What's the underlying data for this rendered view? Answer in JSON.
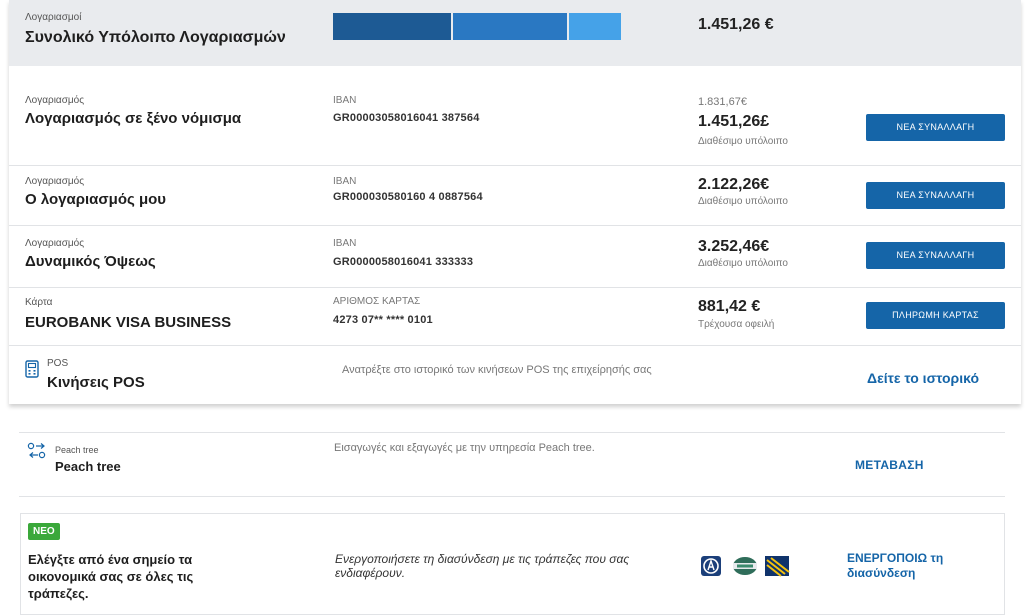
{
  "summary": {
    "small": "Λογαριασμοί",
    "title": "Συνολικό Υπόλοιπο Λογαριασμών",
    "amount": "1.451,26 €"
  },
  "rows": [
    {
      "small": "Λογαριασμός",
      "title": "Λογαριασμός σε ξένο νόμισμα",
      "id_label": "IBAN",
      "id_value": "GR00003058016041   387564",
      "prev_amount": "1.831,67€",
      "amount": "1.451,26£",
      "sub": "Διαθέσιμο υπόλοιπο",
      "button": "ΝΕΑ ΣΥΝΑΛΛΑΓΗ"
    },
    {
      "small": "Λογαριασμός",
      "title": "Ο λογαριασμός μου",
      "id_label": "IBAN",
      "id_value": "GR000030580160 4      0887564",
      "amount": "2.122,26€",
      "sub": "Διαθέσιμο υπόλοιπο",
      "button": "ΝΕΑ ΣΥΝΑΛΛΑΓΗ"
    },
    {
      "small": "Λογαριασμός",
      "title": "Δυναμικός Όψεως",
      "id_label": "IBAN",
      "id_value": "GR0000058016041        333333",
      "amount": "3.252,46€",
      "sub": "Διαθέσιμο υπόλοιπο",
      "button": "ΝΕΑ ΣΥΝΑΛΛΑΓΗ"
    },
    {
      "small": "Κάρτα",
      "title": "EUROBANK VISA BUSINESS",
      "id_label": "ΑΡΙΘΜΟΣ ΚΑΡΤΑΣ",
      "id_value": "4273 07** **** 0101",
      "amount": "881,42 €",
      "sub": "Τρέχουσα οφειλή",
      "button": "ΠΛΗΡΩΜΗ ΚΑΡΤΑΣ"
    }
  ],
  "pos": {
    "small": "POS",
    "title": "Κινήσεις POS",
    "desc": "Ανατρέξτε στο ιστορικό των κινήσεων POS της επιχείρησής σας",
    "link": "Δείτε το ιστορικό"
  },
  "peach": {
    "small": "Peach tree",
    "title": "Peach tree",
    "desc": "Εισαγωγές και εξαγωγές με την υπηρεσία Peach tree.",
    "link": "ΜΕΤΑΒΑΣΗ"
  },
  "promo": {
    "badge": "ΝΕΟ",
    "title": "Ελέγξτε από ένα σημείο τα οικονομικά σας σε όλες τις τράπεζες.",
    "desc": "Ενεργοποιήσετε τη διασύνδεση με τις τράπεζες που σας ενδιαφέρουν.",
    "link": "ΕΝΕΡΓΟΠΟΙΩ τη διασύνδεση"
  },
  "colors": {
    "accent": "#1565a8",
    "bar_dark": "#1d5a94",
    "bar_mid": "#2a78c2",
    "bar_light": "#45a2e8",
    "badge_green": "#3aa83a"
  },
  "icons": {
    "pos": "pos-terminal-icon",
    "peach": "sync-arrows-icon",
    "bank_logos": [
      "bank-logo-blue-icon",
      "bank-logo-green-icon",
      "bank-logo-yellow-icon"
    ]
  }
}
